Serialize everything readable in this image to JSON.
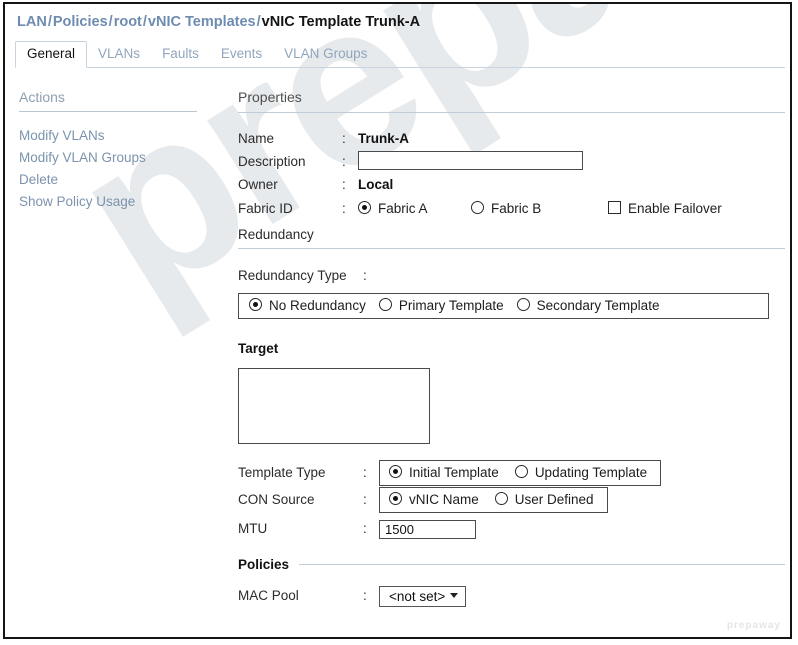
{
  "breadcrumb": {
    "items": [
      "LAN",
      "Policies",
      "root",
      "vNIC Templates"
    ],
    "separator": "/",
    "current": "vNIC Template Trunk-A"
  },
  "tabs": [
    {
      "label": "General",
      "active": true
    },
    {
      "label": "VLANs",
      "active": false
    },
    {
      "label": "Faults",
      "active": false
    },
    {
      "label": "Events",
      "active": false
    },
    {
      "label": "VLAN Groups",
      "active": false
    }
  ],
  "actions": {
    "title": "Actions",
    "items": [
      {
        "label": "Modify VLANs"
      },
      {
        "label": "Modify VLAN Groups"
      },
      {
        "label": "Delete"
      },
      {
        "label": "Show Policy Usage"
      }
    ]
  },
  "properties": {
    "title": "Properties",
    "name": {
      "label": "Name",
      "colon": ":",
      "value": "Trunk-A"
    },
    "description": {
      "label": "Description",
      "colon": ":",
      "value": "",
      "placeholder": ""
    },
    "owner": {
      "label": "Owner",
      "colon": ":",
      "value": "Local"
    },
    "fabric_id": {
      "label": "Fabric ID",
      "colon": ":",
      "options": [
        {
          "label": "Fabric A",
          "selected": true
        },
        {
          "label": "Fabric B",
          "selected": false
        }
      ],
      "enable_failover": {
        "label": "Enable Failover",
        "checked": false
      }
    },
    "redundancy_label": "Redundancy"
  },
  "redundancy": {
    "type_label": "Redundancy Type",
    "colon": ":",
    "options": [
      {
        "label": "No Redundancy",
        "selected": true
      },
      {
        "label": "Primary Template",
        "selected": false
      },
      {
        "label": "Secondary Template",
        "selected": false
      }
    ]
  },
  "target": {
    "title": "Target",
    "items": []
  },
  "template_type": {
    "label": "Template Type",
    "colon": ":",
    "options": [
      {
        "label": "Initial Template",
        "selected": true
      },
      {
        "label": "Updating  Template",
        "selected": false
      }
    ]
  },
  "cdn_source": {
    "label": "CON Source",
    "colon": ":",
    "options": [
      {
        "label": "vNIC Name",
        "selected": true
      },
      {
        "label": "User Defined",
        "selected": false
      }
    ]
  },
  "mtu": {
    "label": "MTU",
    "colon": ":",
    "value": "1500"
  },
  "policies": {
    "title": "Policies",
    "mac_pool": {
      "label": "MAC Pool",
      "colon": ":",
      "value": "<not set>"
    }
  },
  "watermark": {
    "main": "prepaway",
    "corner": "prepaway"
  },
  "colors": {
    "breadcrumb_link": "#6e8cb0",
    "breadcrumb_current": "#141414",
    "tab_inactive": "#8fa6bd",
    "tab_active": "#141414",
    "action_link": "#7b93ad",
    "rule": "#c2ccd6",
    "border": "#4a4a4a",
    "watermark": "#dfe2e5"
  }
}
